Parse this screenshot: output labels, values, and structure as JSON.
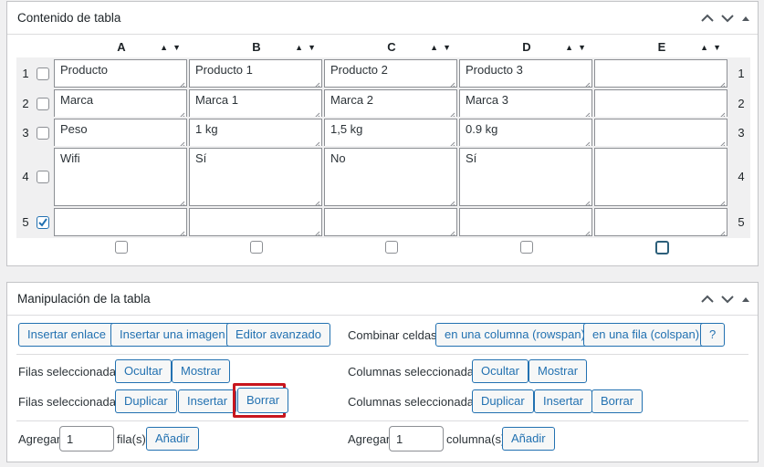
{
  "table_box": {
    "title": "Contenido de tabla",
    "columns": [
      "A",
      "B",
      "C",
      "D",
      "E"
    ],
    "rows": [
      {
        "number": "1",
        "checked": false,
        "cells": [
          "Producto",
          "Producto 1",
          "Producto 2",
          "Producto 3",
          ""
        ]
      },
      {
        "number": "2",
        "checked": false,
        "cells": [
          "Marca",
          "Marca 1",
          "Marca 2",
          "Marca 3",
          ""
        ]
      },
      {
        "number": "3",
        "checked": false,
        "cells": [
          "Peso",
          "1 kg",
          "1,5 kg",
          "0.9 kg",
          ""
        ]
      },
      {
        "number": "4",
        "checked": false,
        "cells": [
          "Wifi",
          "Sí",
          "No",
          "Sí",
          ""
        ]
      },
      {
        "number": "5",
        "checked": true,
        "cells": [
          "",
          "",
          "",
          "",
          ""
        ]
      }
    ]
  },
  "manip_box": {
    "title": "Manipulación de la tabla",
    "insert_link": "Insertar enlace",
    "insert_image": "Insertar una imagen",
    "advanced_editor": "Editor avanzado",
    "combine_cells_label": "Combinar celdas:",
    "rowspan": "en una columna (rowspan)",
    "colspan": "en una fila (colspan)",
    "help": "?",
    "rows_selected_label": "Filas seleccionadas:",
    "cols_selected_label": "Columnas seleccionadas:",
    "hide": "Ocultar",
    "show": "Mostrar",
    "duplicate": "Duplicar",
    "insert": "Insertar",
    "delete": "Borrar",
    "add_label": "Agregar",
    "add_rows_value": "1",
    "rows_suffix": "fila(s)",
    "add_cols_value": "1",
    "cols_suffix": "columna(s)",
    "add_button": "Añadir"
  }
}
